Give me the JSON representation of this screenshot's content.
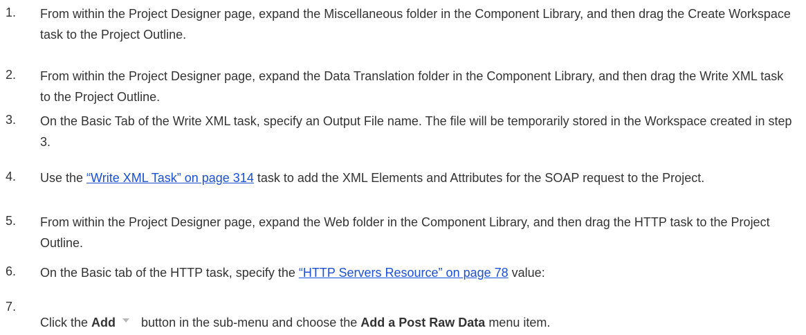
{
  "steps": [
    {
      "number": "1.",
      "text": "From within the Project Designer page, expand the Miscellaneous folder in the Component Library, and then drag the Create Workspace task to the Project Outline."
    },
    {
      "number": "2.",
      "text": "From within the Project Designer page, expand the Data Translation folder in the Component Library, and then drag the Write XML task to the Project Outline."
    },
    {
      "number": "3.",
      "text": "On the Basic Tab of the Write XML task, specify an Output File name. The file will be temporarily stored in the Workspace created in step 3."
    },
    {
      "number": "4.",
      "before": "Use the ",
      "link": "“Write XML Task” on page 314",
      "after": " task to add the XML Elements and Attributes for the SOAP request to the Project."
    },
    {
      "number": "5.",
      "text": "From within the Project Designer page, expand the Web folder in the Component Library, and then drag the HTTP task to the Project Outline."
    },
    {
      "number": "6.",
      "before": "On the Basic tab of the HTTP task, specify the ",
      "link": "“HTTP Servers Resource” on page 78",
      "after": " value:"
    },
    {
      "number": "7.",
      "before": "Click the ",
      "bold1": "Add",
      "icon": "dropdown-arrow-icon",
      "middle": " button in the sub-menu and choose the ",
      "bold2": "Add a Post Raw Data",
      "after": " menu item."
    }
  ]
}
